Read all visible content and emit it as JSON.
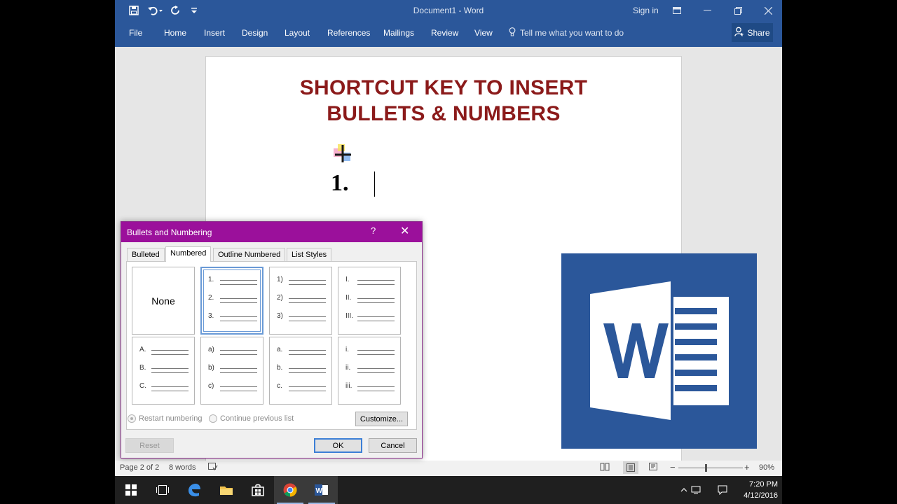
{
  "app": {
    "window_title": "Document1 - Word",
    "sign_in": "Sign in",
    "share_label": "Share"
  },
  "ribbon": {
    "tabs": [
      "File",
      "Home",
      "Insert",
      "Design",
      "Layout",
      "References",
      "Mailings",
      "Review",
      "View"
    ],
    "tell_me": "Tell me what you want to do"
  },
  "document": {
    "heading_line1": "SHORTCUT KEY TO INSERT",
    "heading_line2": "BULLETS & NUMBERS",
    "list_number": "1."
  },
  "dialog": {
    "title": "Bullets and Numbering",
    "help": "?",
    "close": "✕",
    "tabs": [
      "Bulleted",
      "Numbered",
      "Outline Numbered",
      "List Styles"
    ],
    "active_tab": "Numbered",
    "none_label": "None",
    "formats": [
      [
        "1.",
        "2.",
        "3."
      ],
      [
        "1)",
        "2)",
        "3)"
      ],
      [
        "I.",
        "II.",
        "III."
      ],
      [
        "A.",
        "B.",
        "C."
      ],
      [
        "a)",
        "b)",
        "c)"
      ],
      [
        "a.",
        "b.",
        "c."
      ],
      [
        "i.",
        "ii.",
        "iii."
      ]
    ],
    "restart_label": "Restart numbering",
    "continue_label": "Continue previous list",
    "customize_label": "Customize...",
    "reset_label": "Reset",
    "ok_label": "OK",
    "cancel_label": "Cancel"
  },
  "status": {
    "page": "Page 2 of 2",
    "words": "8 words",
    "zoom_minus": "−",
    "zoom_plus": "+",
    "zoom": "90%"
  },
  "taskbar": {
    "time": "7:20 PM",
    "date": "4/12/2016"
  },
  "colors": {
    "word_blue": "#2b579a",
    "heading_red": "#8b1a1a",
    "dialog_title": "#9b109b"
  },
  "icons": [
    "save-icon",
    "undo-icon",
    "redo-icon",
    "customize-qat-icon",
    "lightbulb-icon",
    "person-icon",
    "windows-start-icon",
    "task-view-icon",
    "edge-icon",
    "file-explorer-icon",
    "store-icon",
    "chrome-icon",
    "word-icon"
  ]
}
